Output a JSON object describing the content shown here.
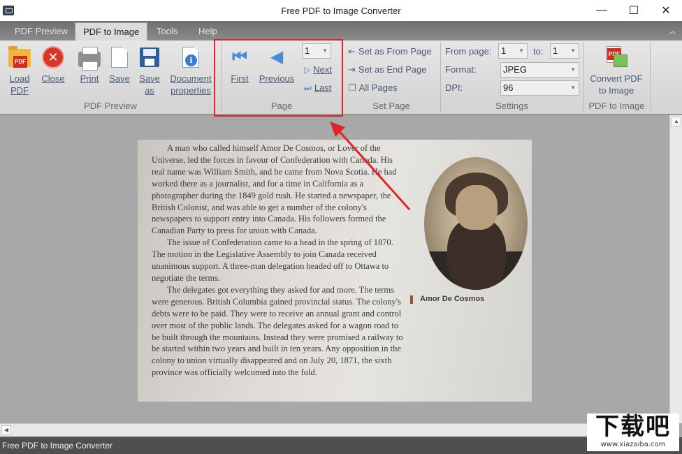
{
  "window": {
    "title": "Free PDF to Image Converter"
  },
  "tabs": [
    {
      "label": "PDF Preview"
    },
    {
      "label": "PDF to Image"
    },
    {
      "label": "Tools"
    },
    {
      "label": "Help"
    }
  ],
  "ribbon": {
    "pdf_preview": {
      "group_label": "PDF Preview",
      "load_pdf": "Load\nPDF",
      "close": "Close",
      "print": "Print",
      "save": "Save",
      "save_as": "Save\nas",
      "document_properties": "Document\nproperties"
    },
    "page": {
      "group_label": "Page",
      "first": "First",
      "previous": "Previous",
      "next": "Next",
      "last": "Last",
      "page_number": "1"
    },
    "set_page": {
      "group_label": "Set Page",
      "set_from": "Set as From Page",
      "set_end": "Set as End Page",
      "all_pages": "All Pages"
    },
    "settings": {
      "group_label": "Settings",
      "from_label": "From page:",
      "from_value": "1",
      "to_label": "to:",
      "to_value": "1",
      "format_label": "Format:",
      "format_value": "JPEG",
      "dpi_label": "DPI:",
      "dpi_value": "96"
    },
    "convert": {
      "group_label": "PDF to Image",
      "button": "Convert PDF\nto Image"
    }
  },
  "document": {
    "paragraphs": [
      "A man who called himself Amor De Cosmos, or Lover of the Universe, led the forces in favour of Confederation with Canada. His real name was William Smith, and he came from Nova Scotia. He had worked there as a journalist, and for a time in California as a photographer during the 1849 gold rush. He started a newspaper, the British Colonist, and was able to get a number of the colony's newspapers to support entry into Canada. His followers formed the Canadian Party to press for union with Canada.",
      "The issue of Confederation came to a head in the spring of 1870. The motion in the Legislative Assembly to join Canada received unanimous support. A three-man delegation headed off to Ottawa to negotiate the terms.",
      "The delegates got everything they asked for and more. The terms were generous. British Columbia gained provincial status. The colony's debts were to be paid. They were to receive an annual grant and control over most of the public lands. The delegates asked for a wagon road to be built through the mountains. Instead they were promised a railway to be started within two years and built in ten years. Any opposition in the colony to union virtually disappeared and on July 20, 1871, the sixth province was officially welcomed into the fold."
    ],
    "caption": "Amor De Cosmos"
  },
  "status_bar": {
    "text": "Free PDF to Image Converter"
  },
  "watermark": {
    "main": "下载吧",
    "sub": "www.xiazaiba.com"
  },
  "colors": {
    "highlight": "#e0252a",
    "ribbon_text": "#4a5a78",
    "viewer_bg": "#a8a8a8"
  }
}
